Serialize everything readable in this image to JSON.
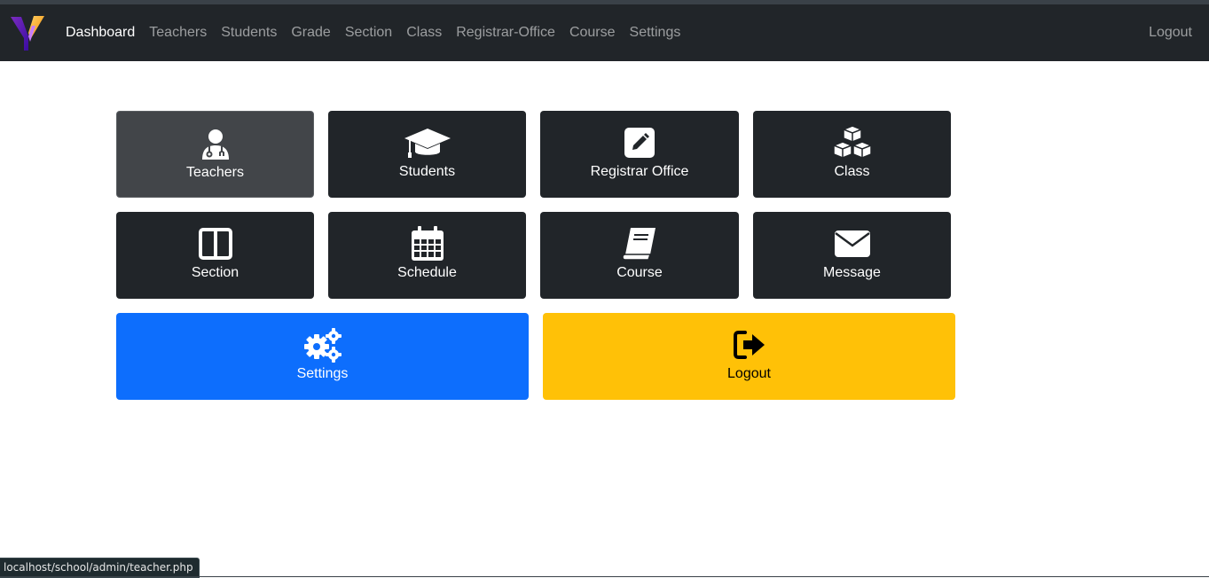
{
  "navbar": {
    "brand_icon": "y-logo-icon",
    "links": [
      "Dashboard",
      "Teachers",
      "Students",
      "Grade",
      "Section",
      "Class",
      "Registrar-Office",
      "Course",
      "Settings"
    ],
    "active": "Dashboard",
    "logout": "Logout"
  },
  "tiles": {
    "teachers": {
      "label": "Teachers",
      "icon": "user-doctor-icon"
    },
    "students": {
      "label": "Students",
      "icon": "graduation-cap-icon"
    },
    "registrar": {
      "label": "Registrar Office",
      "icon": "pen-square-icon"
    },
    "class": {
      "label": "Class",
      "icon": "cubes-icon"
    },
    "section": {
      "label": "Section",
      "icon": "columns-icon"
    },
    "schedule": {
      "label": "Schedule",
      "icon": "calendar-icon"
    },
    "course": {
      "label": "Course",
      "icon": "book-icon"
    },
    "message": {
      "label": "Message",
      "icon": "envelope-icon"
    },
    "settings": {
      "label": "Settings",
      "icon": "cogs-icon"
    },
    "logout": {
      "label": "Logout",
      "icon": "sign-out-icon"
    }
  },
  "statusbar": {
    "url": "localhost/school/admin/teacher.php"
  },
  "colors": {
    "navbar": "#212529",
    "tile": "#212529",
    "tile_hover": "#424549",
    "primary": "#0d6efd",
    "warning": "#ffc107"
  }
}
